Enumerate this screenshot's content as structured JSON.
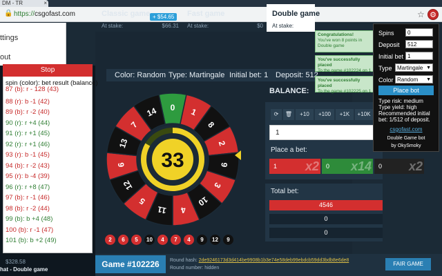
{
  "browser": {
    "tab_title": "DM - TR",
    "url_scheme": "https://",
    "url_host": "csgofast.com"
  },
  "site_menu": {
    "items": [
      "ttings",
      "out"
    ]
  },
  "modes": [
    {
      "name": "Classic game",
      "stake_label": "At stake:",
      "amount": "$66.31",
      "badge": "+ $54.65"
    },
    {
      "name": "Fast game",
      "stake_label": "At stake:",
      "amount": "$0"
    },
    {
      "name": "Double game",
      "stake_label": "At stake:",
      "amount": ""
    }
  ],
  "info": {
    "color": "Color: Random",
    "type": "Type: Martingale",
    "initial": "Initial bet: 1",
    "deposit": "Deposit: 512"
  },
  "wheel": {
    "result": "33",
    "numbers": [
      "0",
      "1",
      "8",
      "2",
      "9",
      "3",
      "10",
      "4",
      "11",
      "5",
      "12",
      "6",
      "13",
      "7",
      "14"
    ],
    "colors": [
      "green",
      "red",
      "black",
      "red",
      "black",
      "red",
      "black",
      "red",
      "black",
      "red",
      "black",
      "red",
      "black",
      "red",
      "black"
    ]
  },
  "history": [
    {
      "n": "2",
      "c": "red"
    },
    {
      "n": "6",
      "c": "red"
    },
    {
      "n": "5",
      "c": "red"
    },
    {
      "n": "10",
      "c": "black"
    },
    {
      "n": "4",
      "c": "red"
    },
    {
      "n": "7",
      "c": "red"
    },
    {
      "n": "4",
      "c": "red"
    },
    {
      "n": "9",
      "c": "black"
    },
    {
      "n": "12",
      "c": "black"
    },
    {
      "n": "9",
      "c": "black"
    }
  ],
  "betting": {
    "balance_label": "BALANCE:",
    "controls": [
      "⟳",
      "🗑",
      "+10",
      "+100",
      "+1K",
      "+10K"
    ],
    "input_value": "1",
    "place_label": "Place a bet:",
    "buttons": [
      {
        "value": "1",
        "mult": "x2",
        "color": "#d32f2f"
      },
      {
        "value": "0",
        "mult": "x14",
        "color": "#2e8b3a"
      },
      {
        "value": "0",
        "mult": "x2",
        "color": "#222222"
      }
    ],
    "total_label": "Total bet:",
    "totals": [
      {
        "value": "4546",
        "color": "#d32f2f"
      },
      {
        "value": "0",
        "color": "#1f3140"
      },
      {
        "value": "0",
        "color": "#1f3140"
      }
    ]
  },
  "footer": {
    "game_id": "Game #102226",
    "hash_label": "Round hash:",
    "hash_value": "2de9246173d3d414be9908b1b3e74e58deb99ebdcb59dd3bdb8e6de8",
    "round_label": "Round number: hidden",
    "fair_button": "FAIR GAME",
    "chat_label": "hat - Double game",
    "chat_balance": "$328.58"
  },
  "bot_log": {
    "stop_label": "Stop",
    "header": "spin (color): bet result (balance)",
    "lines": [
      {
        "text": "87 (b): r - 128 (43)",
        "c": "red"
      },
      {
        "text": "88 (r): b -1 (42)",
        "c": "red"
      },
      {
        "text": "89 (b): r -2 (40)",
        "c": "red"
      },
      {
        "text": "90 (r): r +4 (44)",
        "c": "green"
      },
      {
        "text": "91 (r): r +1 (45)",
        "c": "green"
      },
      {
        "text": "92 (r): r +1 (46)",
        "c": "green"
      },
      {
        "text": "93 (r): b -1 (45)",
        "c": "red"
      },
      {
        "text": "94 (b): r -2 (43)",
        "c": "red"
      },
      {
        "text": "95 (r): b -4 (39)",
        "c": "red"
      },
      {
        "text": "96 (r): r +8 (47)",
        "c": "green"
      },
      {
        "text": "97 (b): r -1 (46)",
        "c": "red"
      },
      {
        "text": "98 (b): r -2 (44)",
        "c": "red"
      },
      {
        "text": "99 (b): b +4 (48)",
        "c": "green"
      },
      {
        "text": "100 (b): r -1 (47)",
        "c": "red"
      },
      {
        "text": "101 (b): b +2 (49)",
        "c": "green"
      }
    ]
  },
  "notifications": [
    {
      "title": "Congratulations!",
      "body": "You've won 8 points in Double game"
    },
    {
      "title": "You've successfully placed",
      "body": "To the game #102224 on 1"
    },
    {
      "title": "You've successfully placed",
      "body": "To the game #102225 on 1"
    }
  ],
  "popup": {
    "spins_label": "Spins",
    "spins_value": "0",
    "deposit_label": "Deposit",
    "deposit_value": "512",
    "initial_label": "Initial bet",
    "initial_value": "1",
    "type_label": "Type",
    "type_value": "Martingale",
    "color_label": "Color",
    "color_value": "Random",
    "place_button": "Place bot",
    "info": [
      "Type risk: medium",
      "Type yield: high",
      "Recommended initial",
      "bet: 1/512 of deposit."
    ],
    "link": "csgofast.com",
    "footer1": "Double Game bot",
    "footer2": "by OkySmoky"
  },
  "colors": {
    "red": "#d32f2f",
    "black": "#111111",
    "green": "#2e9b3f",
    "accent": "#2a7fb3",
    "yellow": "#f0d227"
  }
}
